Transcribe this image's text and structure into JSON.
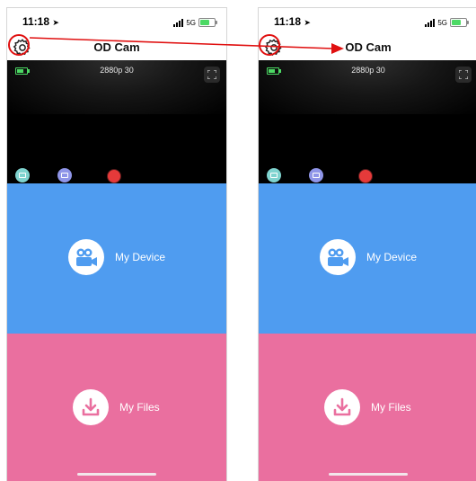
{
  "screens": [
    {
      "status": {
        "time": "11:18",
        "network": "5G"
      },
      "nav": {
        "title": "OD Cam"
      },
      "preview": {
        "resolution": "2880p 30"
      },
      "device_button": {
        "label": "My Device"
      },
      "files_button": {
        "label": "My Files"
      }
    },
    {
      "status": {
        "time": "11:18",
        "network": "5G"
      },
      "nav": {
        "title": "OD Cam"
      },
      "preview": {
        "resolution": "2880p 30"
      },
      "device_button": {
        "label": "My Device"
      },
      "files_button": {
        "label": "My Files"
      }
    }
  ],
  "colors": {
    "device_panel": "#4f9cf0",
    "files_panel": "#ea6f9f",
    "annotation": "#e01010",
    "record": "#e53a3a",
    "video_mode": "#7fd3cf",
    "photo_mode": "#8f95e8"
  },
  "icons": {
    "settings": "gear-icon",
    "fullscreen": "expand-icon",
    "device": "video-camera-icon",
    "files": "download-icon",
    "location": "location-arrow-icon"
  }
}
